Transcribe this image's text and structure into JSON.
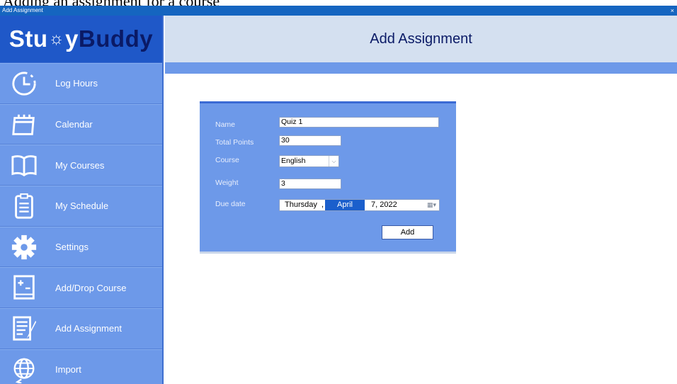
{
  "caption": "Adding an assignment for a course",
  "window": {
    "title": "Add Assignment",
    "close_symbol": "×"
  },
  "logo": {
    "part1": "Stu",
    "bulb": "☼",
    "part2": "y",
    "part3": "Buddy"
  },
  "sidebar": {
    "items": [
      {
        "label": "Log Hours",
        "icon": "clock-icon"
      },
      {
        "label": "Calendar",
        "icon": "calendar-icon"
      },
      {
        "label": "My Courses",
        "icon": "book-icon"
      },
      {
        "label": "My Schedule",
        "icon": "clipboard-icon"
      },
      {
        "label": "Settings",
        "icon": "gear-icon"
      },
      {
        "label": "Add/Drop Course",
        "icon": "plus-minus-icon"
      },
      {
        "label": "Add Assignment",
        "icon": "document-pen-icon"
      },
      {
        "label": "Import",
        "icon": "globe-import-icon"
      }
    ]
  },
  "header": {
    "title": "Add Assignment"
  },
  "form": {
    "name_label": "Name",
    "name_value": "Quiz 1",
    "total_points_label": "Total Points",
    "total_points_value": "30",
    "course_label": "Course",
    "course_value": "English",
    "weight_label": "Weight",
    "weight_value": "3",
    "due_date_label": "Due date",
    "due_date": {
      "day_of_week": "Thursday",
      "comma": ",",
      "month": "April",
      "day_year": "7, 2022"
    },
    "add_button": "Add"
  },
  "colors": {
    "sidebar_bg": "#6d99e9",
    "logo_bg": "#1f58c8",
    "header_bg": "#d4e0f0",
    "titlebar_bg": "#1565c0",
    "header_text": "#0a1a66"
  }
}
